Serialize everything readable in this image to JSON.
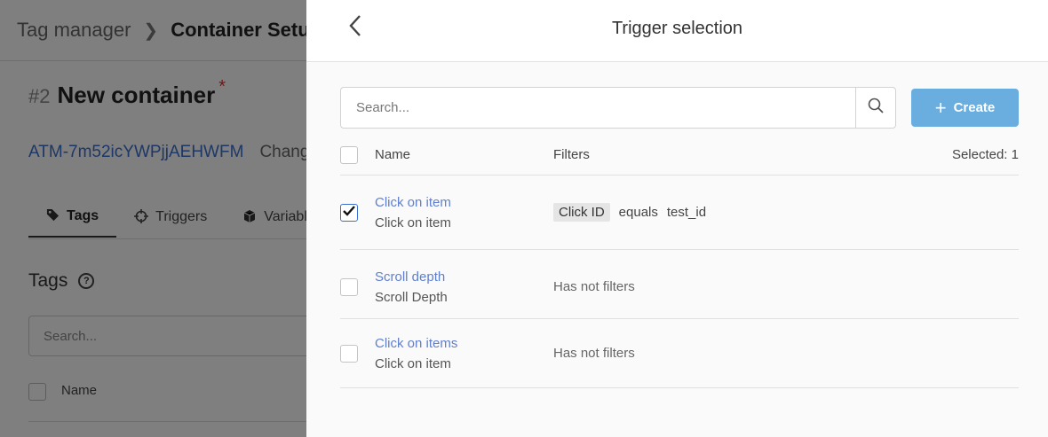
{
  "background": {
    "breadcrumb": [
      "Tag manager",
      "Container Setu"
    ],
    "container_number": "#2",
    "container_name": "New container",
    "required_mark": "*",
    "container_id": "ATM-7m52icYWPjjAEHWFM",
    "change_label": "Chang",
    "tabs": [
      {
        "label": "Tags",
        "icon": "tag-icon"
      },
      {
        "label": "Triggers",
        "icon": "crosshair-icon"
      },
      {
        "label": "Variabl",
        "icon": "cube-icon"
      }
    ],
    "section_title": "Tags",
    "search_placeholder": "Search...",
    "list_header": "Name"
  },
  "panel": {
    "title": "Trigger selection",
    "search_placeholder": "Search...",
    "create_label": "Create",
    "columns": {
      "name": "Name",
      "filters": "Filters"
    },
    "selected_label": "Selected: 1",
    "rows": [
      {
        "name": "Click on item",
        "type": "Click on item",
        "checked": true,
        "filter": {
          "field": "Click ID",
          "op": "equals",
          "value": "test_id"
        },
        "no_filters": ""
      },
      {
        "name": "Scroll depth",
        "type": "Scroll Depth",
        "checked": false,
        "filter": null,
        "no_filters": "Has not filters"
      },
      {
        "name": "Click on items",
        "type": "Click on item",
        "checked": false,
        "filter": null,
        "no_filters": "Has not filters"
      }
    ]
  },
  "colors": {
    "accent": "#6aaee0",
    "link": "#5f7fd0",
    "overlay": "rgba(0,0,0,0.5)"
  }
}
